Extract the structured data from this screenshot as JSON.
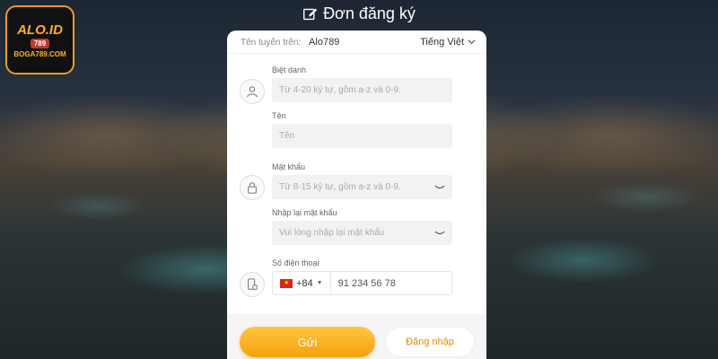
{
  "logo": {
    "brand": "ALO.ID",
    "badge": "789",
    "domain": "BOGA789.COM"
  },
  "header": {
    "title": "Đơn đăng ký"
  },
  "topbar": {
    "ref_label": "Tên tuyến trên:",
    "ref_value": "Alo789",
    "language": "Tiếng Việt"
  },
  "form": {
    "nickname": {
      "label": "Biệt danh",
      "placeholder": "Từ 4-20 ký tự, gồm a-z và 0-9."
    },
    "name": {
      "label": "Tên",
      "placeholder": "Tên"
    },
    "password": {
      "label": "Mật khẩu",
      "placeholder": "Từ 8-15 ký tự, gồm a-z và 0-9."
    },
    "confirm": {
      "label": "Nhập lại mật khẩu",
      "placeholder": "Vui lòng nhập lại mật khẩu"
    },
    "phone": {
      "label": "Số điện thoại",
      "country_code": "+84",
      "placeholder": "91 234 56 78"
    }
  },
  "buttons": {
    "submit": "Gửi",
    "login": "Đăng nhập"
  }
}
